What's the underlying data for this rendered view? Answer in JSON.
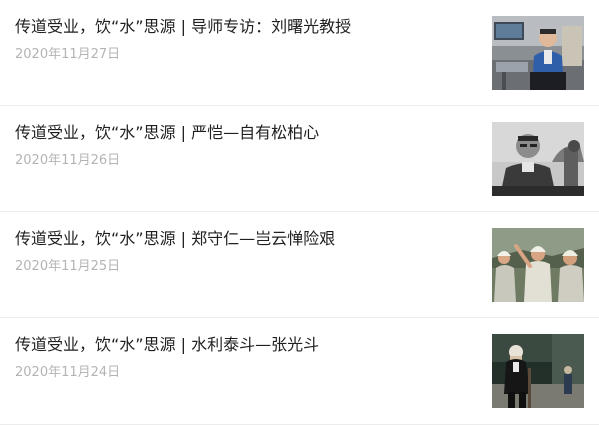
{
  "articles": [
    {
      "title": "传道受业，饮“水”思源 | 导师专访：刘曙光教授",
      "date": "2020年11月27日",
      "thumbnail": "professor-seated-office-photo"
    },
    {
      "title": "传道受业，饮“水”思源 | 严恺—自有松柏心",
      "date": "2020年11月26日",
      "thumbnail": "black-white-portrait-photo"
    },
    {
      "title": "传道受业，饮“水”思源 | 郑守仁—岂云惮险艰",
      "date": "2020年11月25日",
      "thumbnail": "engineers-hardhats-photo"
    },
    {
      "title": "传道受业，饮“水”思源 | 水利泰斗—张光斗",
      "date": "2020年11月24日",
      "thumbnail": "elderly-man-walking-photo"
    }
  ],
  "colors": {
    "title": "#1f1f1f",
    "date": "#b4b4b4",
    "divider": "#ececec"
  }
}
